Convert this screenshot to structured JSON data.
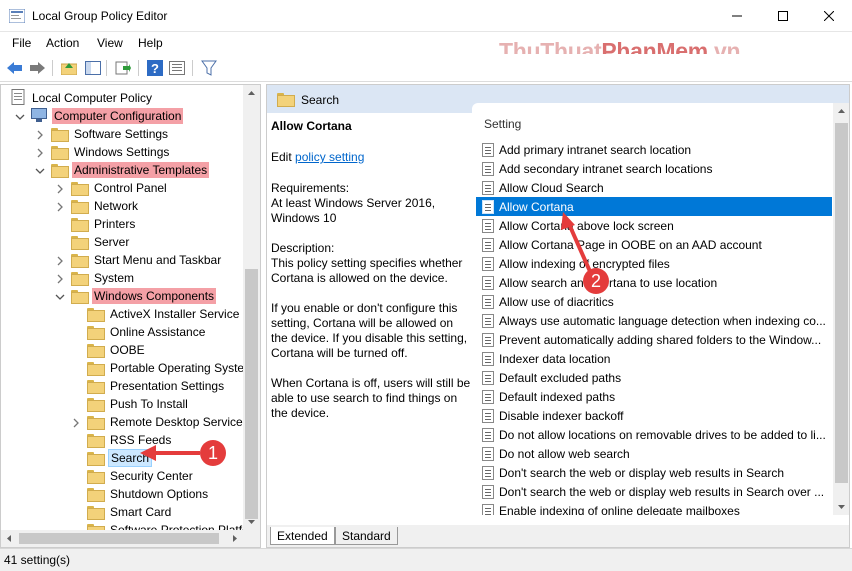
{
  "window": {
    "title": "Local Group Policy Editor"
  },
  "menu": [
    "File",
    "Action",
    "View",
    "Help"
  ],
  "watermark": {
    "part1": "ThuThuat",
    "part2": "PhanMem",
    "part3": ".vn"
  },
  "tree": [
    {
      "label": "Local Computer Policy",
      "level": 0
    },
    {
      "label": "Computer Configuration",
      "level": 1,
      "highlight": true
    },
    {
      "label": "Software Settings",
      "level": 2
    },
    {
      "label": "Windows Settings",
      "level": 2
    },
    {
      "label": "Administrative Templates",
      "level": 2,
      "highlight": true
    },
    {
      "label": "Control Panel",
      "level": 3
    },
    {
      "label": "Network",
      "level": 3
    },
    {
      "label": "Printers",
      "level": 3
    },
    {
      "label": "Server",
      "level": 3
    },
    {
      "label": "Start Menu and Taskbar",
      "level": 3
    },
    {
      "label": "System",
      "level": 3
    },
    {
      "label": "Windows Components",
      "level": 3,
      "highlight": true
    },
    {
      "label": "ActiveX Installer Service",
      "level": 4
    },
    {
      "label": "Online Assistance",
      "level": 4
    },
    {
      "label": "OOBE",
      "level": 4
    },
    {
      "label": "Portable Operating System",
      "level": 4
    },
    {
      "label": "Presentation Settings",
      "level": 4
    },
    {
      "label": "Push To Install",
      "level": 4
    },
    {
      "label": "Remote Desktop Services",
      "level": 4
    },
    {
      "label": "RSS Feeds",
      "level": 4
    },
    {
      "label": "Search",
      "level": 4,
      "selected": true
    },
    {
      "label": "Security Center",
      "level": 4
    },
    {
      "label": "Shutdown Options",
      "level": 4
    },
    {
      "label": "Smart Card",
      "level": 4
    },
    {
      "label": "Software Protection Platfo",
      "level": 4
    }
  ],
  "right": {
    "header": "Search",
    "policy_title": "Allow Cortana",
    "edit_prefix": "Edit ",
    "edit_link": "policy setting ",
    "requirements": "Requirements:\nAt least Windows Server 2016, Windows 10",
    "description": "Description:\nThis policy setting specifies whether Cortana is allowed on the device.",
    "para1": "If you enable or don't configure this setting, Cortana will be allowed on the device. If you disable this setting, Cortana will be turned off.",
    "para2": "When Cortana is off, users will still be able to use search to find things on the device.",
    "list_header": "Setting",
    "settings": [
      "Add primary intranet search location",
      "Add secondary intranet search locations",
      "Allow Cloud Search",
      "Allow Cortana",
      "Allow Cortana above lock screen",
      "Allow Cortana Page in OOBE on an AAD account",
      "Allow indexing of encrypted files",
      "Allow search and Cortana to use location",
      "Allow use of diacritics",
      "Always use automatic language detection when indexing co...",
      "Prevent automatically adding shared folders to the Window...",
      "Indexer data location",
      "Default excluded paths",
      "Default indexed paths",
      "Disable indexer backoff",
      "Do not allow locations on removable drives to be added to li...",
      "Do not allow web search",
      "Don't search the web or display web results in Search",
      "Don't search the web or display web results in Search over ...",
      "Enable indexing of online delegate mailboxes"
    ],
    "tabs": [
      "Extended",
      "Standard"
    ]
  },
  "status": "41 setting(s)",
  "badges": [
    "1",
    "2"
  ]
}
